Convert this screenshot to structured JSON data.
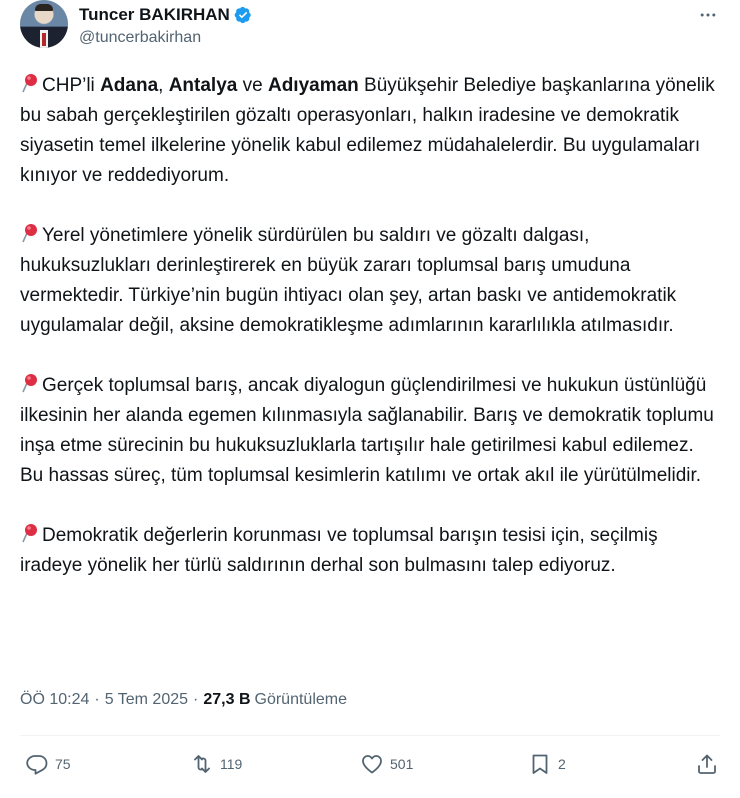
{
  "author": {
    "display_name": "Tuncer BAKIRHAN",
    "handle": "@tuncerbakirhan",
    "verified": true,
    "accent_color": "#1d9bf0"
  },
  "icons": {
    "pin": "round-pushpin-emoji",
    "more": "more-horizontal-icon",
    "reply": "reply-icon",
    "retweet": "retweet-icon",
    "like": "heart-icon",
    "bookmark": "bookmark-icon",
    "share": "share-icon"
  },
  "body": {
    "p1": {
      "t1": "CHP’li ",
      "b1": "Adana",
      "t2": ", ",
      "b2": "Antalya",
      "t3": " ve ",
      "b3": "Adıyaman",
      "t4": " Büyükşehir Belediye başkanlarına yönelik bu sabah gerçekleştirilen gözaltı operasyonları, halkın iradesine ve demokratik siyasetin temel ilkelerine yönelik kabul edilemez müdahalelerdir. Bu uygulamaları kınıyor ve reddediyorum."
    },
    "p2": "Yerel yönetimlere yönelik sürdürülen bu saldırı ve gözaltı dalgası, hukuksuzlukları derinleştirerek en büyük zararı toplumsal barış umuduna vermektedir. Türkiye’nin bugün ihtiyacı olan şey, artan baskı ve antidemokratik uygulamalar değil, aksine demokratikleşme adımlarının kararlılıkla atılmasıdır.",
    "p3": "Gerçek toplumsal barış, ancak diyalogun güçlendirilmesi ve hukukun üstünlüğü ilkesinin her alanda egemen kılınmasıyla sağlanabilir. Barış ve demokratik toplumu inşa etme sürecinin bu hukuksuzluklarla tartışılır hale getirilmesi kabul edilemez. Bu hassas süreç, tüm toplumsal kesimlerin katılımı ve ortak akıl ile yürütülmelidir.",
    "p4": "Demokratik değerlerin korunması ve toplumsal barışın tesisi için, seçilmiş iradeye yönelik her türlü saldırının derhal son bulmasını talep ediyoruz."
  },
  "meta": {
    "time": "ÖÖ 10:24",
    "separator": "·",
    "date": "5 Tem 2025",
    "views_count": "27,3 B",
    "views_label": "Görüntüleme"
  },
  "actions": {
    "replies": "75",
    "retweets": "119",
    "likes": "501",
    "bookmarks": "2"
  }
}
